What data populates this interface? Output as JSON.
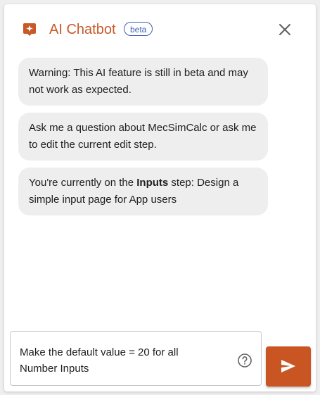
{
  "header": {
    "title": "AI Chatbot",
    "badge": "beta",
    "logo_icon": "sparkle-chat-icon",
    "close_icon": "close-icon"
  },
  "messages": [
    {
      "text": "Warning: This AI feature is still in beta and may not work as expected."
    },
    {
      "text": "Ask me a question about MecSimCalc or ask me to edit the current edit step."
    },
    {
      "prefix": "You're currently on the ",
      "bold": "Inputs",
      "suffix": " step: Design a simple input page for App users"
    }
  ],
  "composer": {
    "value": "Make the default value = 20 for all Number Inputs",
    "help_icon": "help-circle-icon",
    "send_icon": "send-icon"
  },
  "colors": {
    "accent": "#c85a2a",
    "badge": "#3f5fb4",
    "bubble_bg": "#eeeeee"
  }
}
